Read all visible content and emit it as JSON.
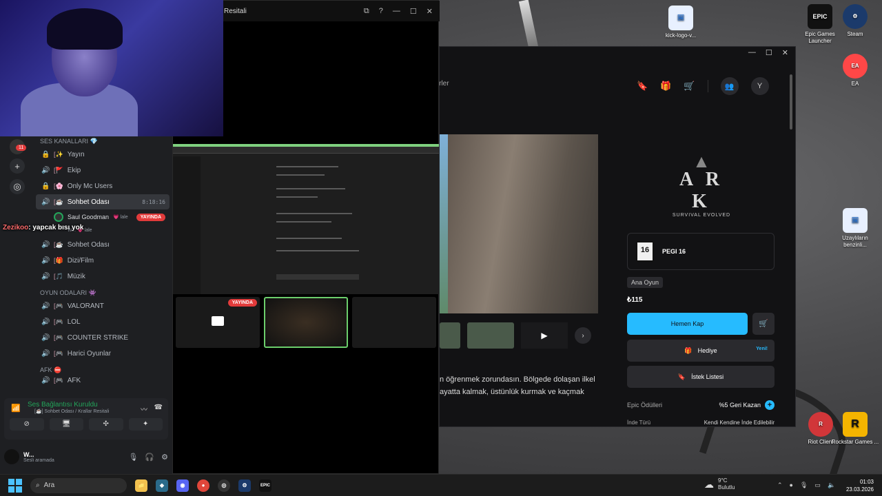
{
  "desktop": {
    "icons": [
      {
        "name": "kick-logo-icon",
        "label": "kick-logo-v...",
        "color": "#e8f0ff"
      },
      {
        "name": "epic-games-icon",
        "label": "Epic Games Launcher",
        "color": "#111111"
      },
      {
        "name": "steam-icon",
        "label": "Steam",
        "color": "#1b3a6b"
      },
      {
        "name": "ea-icon",
        "label": "EA",
        "color": "#ff4747"
      },
      {
        "name": "shortcut-icon",
        "label": "Uzaylıların benzinli...",
        "color": "#e8f0ff"
      },
      {
        "name": "riot-client-icon",
        "label": "Riot Client",
        "color": "#d13639"
      },
      {
        "name": "rockstar-icon",
        "label": "Rockstar Games ...",
        "color": "#f4b400"
      }
    ]
  },
  "stream_window": {
    "title": "Resitali",
    "live_label": "YAYINDA"
  },
  "discord": {
    "notif_count": "11",
    "voice_category": "SES KANALLARI 💎",
    "channels": [
      {
        "prefix": "🔒 [",
        "emoji": "✨",
        "label": "Yayın",
        "icon": "lock"
      },
      {
        "prefix": "🔊 [",
        "emoji": "🚩",
        "label": "Ekip",
        "icon": "speaker"
      },
      {
        "prefix": "🔒 [",
        "emoji": "🌸",
        "label": "Only Mc Users",
        "icon": "lock"
      },
      {
        "prefix": "🔊 [",
        "emoji": "☕",
        "label": "Sohbet Odası",
        "icon": "speaker",
        "active": true,
        "timer": "8:18:16"
      }
    ],
    "voice_user": {
      "name": "Saul Goodman",
      "suffix": "💗 lale",
      "badge": "YAYINDA"
    },
    "voice_user_sub": "W... 💗 lale",
    "channels2": [
      {
        "label": "Sohbet Odası",
        "emoji": "☕"
      },
      {
        "label": "Dizi/Film",
        "emoji": "🎁"
      },
      {
        "label": "Müzik",
        "emoji": "🎵"
      }
    ],
    "game_category": "OYUN ODALARI 👾",
    "game_channels": [
      {
        "label": "VALORANT"
      },
      {
        "label": "LOL"
      },
      {
        "label": "COUNTER STRIKE"
      },
      {
        "label": "Harici Oyunlar"
      }
    ],
    "afk_category": "AFK ⛔",
    "afk_channel": "AFK",
    "chat_overlay": {
      "name": "Zezikoo",
      "message": ": yapcak bısı yok"
    },
    "voice_status": "Ses Bağlantısı Kuruldu",
    "voice_sub": "[☕] Sohbet Odası / Krallar Resitali",
    "user": {
      "name": "W...",
      "status": "Sesli aramada"
    }
  },
  "epic": {
    "nav_partial": "eerler",
    "ark": {
      "title": "A R K",
      "subtitle": "SURVIVAL EVOLVED"
    },
    "pegi": {
      "badge": "16",
      "label": "PEGI 16"
    },
    "tag": "Ana Oyun",
    "price": "₺115",
    "get_button": "Hemen Kap",
    "gift_button": "Hediye",
    "gift_new": "Yeni!",
    "wishlist_button": "İstek Listesi",
    "rewards_label": "Epic Ödülleri",
    "rewards_value": "%5 Geri Kazan",
    "genre_label": "İnde Türü",
    "genre_value": "Kendi Kendine İnde Edilebilir",
    "desc_line1": "n öğrenmek zorundasın. Bölgede dolaşan ilkel",
    "desc_line2": "ayatta kalmak, üstünlük kurmak ve kaçmak",
    "avatar_letter": "Y"
  },
  "taskbar": {
    "search_placeholder": "Ara",
    "weather_temp": "9°C",
    "weather_desc": "Bulutlu",
    "time": "01:03",
    "date": "23.03.2026"
  }
}
